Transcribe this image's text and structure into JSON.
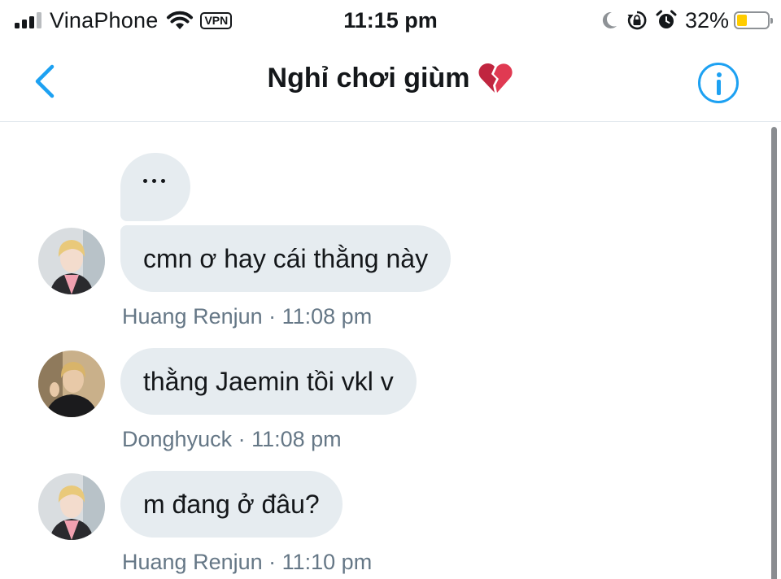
{
  "status_bar": {
    "carrier": "VinaPhone",
    "vpn": "VPN",
    "time": "11:15 pm",
    "battery_percent": "32%",
    "battery_level": 0.32,
    "battery_color": "#ffcc00",
    "icons": [
      "signal-icon",
      "wifi-icon",
      "moon-icon",
      "rotation-lock-icon",
      "alarm-icon",
      "battery-icon"
    ]
  },
  "header": {
    "title": "Nghỉ chơi giùm",
    "title_emoji": "broken-heart-icon",
    "back_icon": "chevron-left-icon",
    "info_icon": "info-icon",
    "accent_color": "#1da1f2"
  },
  "messages": [
    {
      "type": "typing",
      "text": "..."
    },
    {
      "text": "cmn ơ hay cái thằng này",
      "sender": "Huang Renjun",
      "time": "11:08 pm",
      "meta": "Huang Renjun · 11:08 pm"
    },
    {
      "text": "thằng Jaemin tồi vkl v",
      "sender": "Donghyuck",
      "time": "11:08 pm",
      "meta": "Donghyuck · 11:08 pm"
    },
    {
      "text": "m đang ở đâu?",
      "sender": "Huang Renjun",
      "time": "11:10 pm",
      "meta": "Huang Renjun · 11:10 pm"
    }
  ]
}
